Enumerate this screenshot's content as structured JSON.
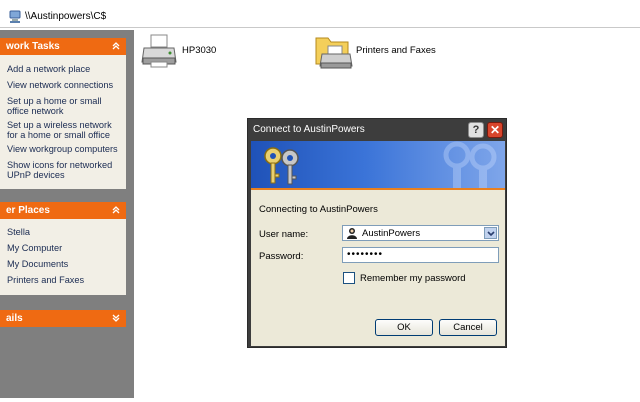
{
  "address_bar": {
    "path": "\\\\Austinpowers\\C$"
  },
  "task_pane": {
    "network_tasks": {
      "header": "work Tasks",
      "items": [
        "Add a network place",
        "View network connections",
        "Set up a home or small office network",
        "Set up a wireless network for a home or small office",
        "View workgroup computers",
        "Show icons for networked UPnP devices"
      ]
    },
    "other_places": {
      "header": "er Places",
      "items": [
        "Stella",
        "My Computer",
        "My Documents",
        "Printers and Faxes"
      ]
    },
    "details": {
      "header": "ails"
    }
  },
  "files": [
    {
      "name": "HP3030",
      "icon": "printer-icon"
    },
    {
      "name": "Printers and Faxes",
      "icon": "printers-folder-icon"
    }
  ],
  "dialog": {
    "title": "Connect to AustinPowers",
    "help_label": "?",
    "close_label": "✕",
    "connecting_text": "Connecting to AustinPowers",
    "username_label": "User name:",
    "username_value": "AustinPowers",
    "password_label": "Password:",
    "password_value": "••••••••",
    "remember_label": "Remember my password",
    "remember_checked": false,
    "ok_label": "OK",
    "cancel_label": "Cancel"
  },
  "colors": {
    "pane_background": "#7f7f7f",
    "group_header": "#ef6a12",
    "group_body": "#f2efe6",
    "dialog_frame": "#3d3d3d",
    "banner_blue": "#1f52b8",
    "dialog_body": "#ece9d8"
  }
}
